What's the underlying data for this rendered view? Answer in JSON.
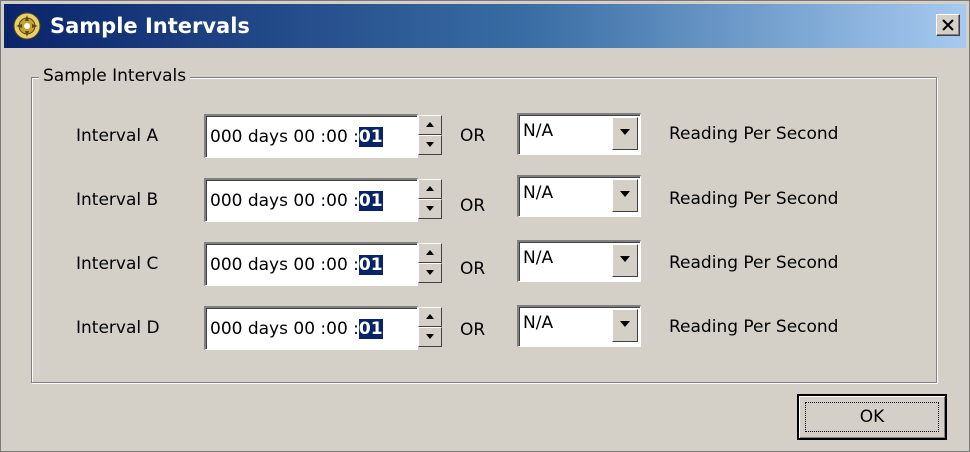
{
  "window": {
    "title": "Sample Intervals",
    "icon": "app-emblem-icon",
    "close_icon": "close-icon"
  },
  "group": {
    "legend": "Sample Intervals"
  },
  "connector": "OR",
  "rows": [
    {
      "label": "Interval A",
      "time_prefix": "000 days 00 :00 :",
      "time_selected": "01",
      "combo_value": "N/A",
      "unit": "Reading Per Second"
    },
    {
      "label": "Interval B",
      "time_prefix": "000 days 00 :00 :",
      "time_selected": "01",
      "combo_value": "N/A",
      "unit": "Reading Per Second"
    },
    {
      "label": "Interval C",
      "time_prefix": "000 days 00 :00 :",
      "time_selected": "01",
      "combo_value": "N/A",
      "unit": "Reading Per Second"
    },
    {
      "label": "Interval D",
      "time_prefix": "000 days 00 :00 :",
      "time_selected": "01",
      "combo_value": "N/A",
      "unit": "Reading Per Second"
    }
  ],
  "ok_label": "OK",
  "colors": {
    "title_gradient_start": "#0a246a",
    "title_gradient_end": "#a6caf0",
    "face": "#d4d0c8",
    "selection": "#0a246a"
  }
}
